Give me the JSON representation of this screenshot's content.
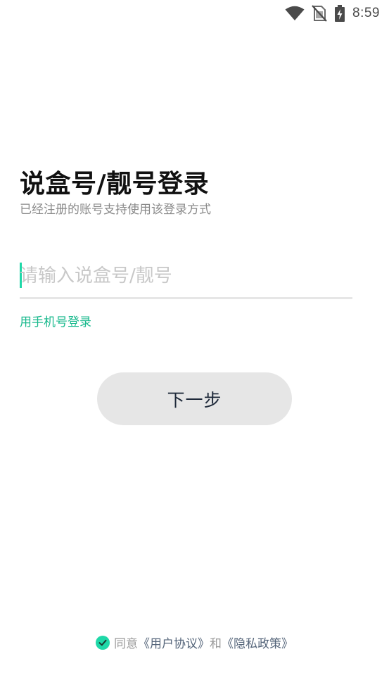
{
  "status_bar": {
    "time": "8:59",
    "icons": [
      "wifi-icon",
      "no-sim-icon",
      "battery-charging-icon"
    ]
  },
  "login": {
    "title": "说盒号/靓号登录",
    "subtitle": "已经注册的账号支持使用该登录方式",
    "input_placeholder": "请输入说盒号/靓号",
    "input_value": "",
    "phone_login_link": "用手机号登录",
    "next_button": "下一步"
  },
  "agreement": {
    "checked": true,
    "prefix": "同意",
    "user_agreement": "《用户协议》",
    "connector": "和",
    "privacy_policy": "《隐私政策》"
  },
  "colors": {
    "accent": "#1fd8a8",
    "link_green": "#19b98d",
    "button_bg": "#e6e6e6",
    "title": "#111111",
    "subtitle": "#8a8a8a"
  }
}
